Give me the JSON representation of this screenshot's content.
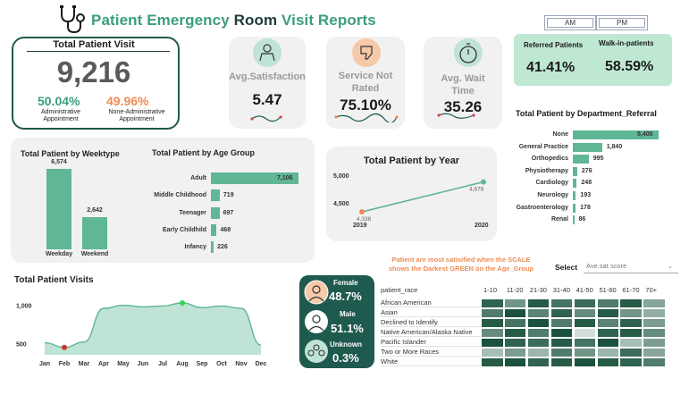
{
  "header": {
    "title_part1": "Patient",
    "title_part2": "Emergency",
    "title_part3": "Room",
    "title_part4": "Visit Reports",
    "am_label": "AM",
    "pm_label": "PM"
  },
  "total_visit": {
    "title": "Total Patient Visit",
    "value": "9,216",
    "admin_pct": "50.04%",
    "admin_label_1": "Administrative",
    "admin_label_2": "Appointment",
    "nonadmin_pct": "49.96%",
    "nonadmin_label_1": "None-Administrative",
    "nonadmin_label_2": "Appointment"
  },
  "kpis": {
    "satisfaction_label": "Avg.Satisfaction",
    "satisfaction_value": "5.47",
    "not_rated_label_1": "Service Not",
    "not_rated_label_2": "Rated",
    "not_rated_value": "75.10%",
    "wait_label_1": "Avg. Wait",
    "wait_label_2": "Time",
    "wait_value": "35.26"
  },
  "referral": {
    "referred_label": "Referred Patients",
    "walkin_label": "Walk-in-patients",
    "referred_value": "41.41%",
    "walkin_value": "58.59%"
  },
  "colors": {
    "accent": "#5fb795",
    "dark_teal": "#1f5a4e",
    "orange": "#f08c55"
  },
  "weektype": {
    "title": "Total Patient by Weektype",
    "chart_data": {
      "type": "bar",
      "categories": [
        "Weekday",
        "Weekend"
      ],
      "values": [
        6574,
        2642
      ],
      "labels": [
        "6,574",
        "2,642"
      ]
    }
  },
  "age_group": {
    "title": "Total Patient by Age Group",
    "chart_data": {
      "type": "bar",
      "categories": [
        "Adult",
        "Middle Childhood",
        "Teenager",
        "Early Childhild",
        "Infancy"
      ],
      "values": [
        7106,
        719,
        697,
        468,
        226
      ],
      "labels": [
        "7,106",
        "719",
        "697",
        "468",
        "226"
      ]
    }
  },
  "year": {
    "title": "Total Patient by Year",
    "chart_data": {
      "type": "line",
      "x": [
        "2019",
        "2020"
      ],
      "values": [
        4338,
        4878
      ],
      "labels": [
        "4,338",
        "4,878"
      ],
      "ylim": [
        4000,
        5000
      ],
      "yticks": [
        "5,000",
        "4,500"
      ]
    }
  },
  "department": {
    "title": "Total Patient by Department_Referral",
    "chart_data": {
      "type": "bar",
      "categories": [
        "None",
        "General Practice",
        "Orthopedics",
        "Physiotherapy",
        "Cardiology",
        "Neurology",
        "Gastroenterology",
        "Renal"
      ],
      "values": [
        5400,
        1840,
        995,
        276,
        248,
        193,
        178,
        86
      ],
      "labels": [
        "5,400",
        "1,840",
        "995",
        "276",
        "248",
        "193",
        "178",
        "86"
      ]
    }
  },
  "visits": {
    "title": "Total Patient Visits",
    "chart_data": {
      "type": "area",
      "x": [
        "Jan",
        "Feb",
        "Mar",
        "Apr",
        "May",
        "Jun",
        "Jul",
        "Aug",
        "Sep",
        "Oct",
        "Nov",
        "Dec"
      ],
      "values": [
        510,
        450,
        520,
        960,
        1000,
        980,
        990,
        1030,
        970,
        990,
        960,
        480
      ],
      "yticks": [
        "1,000",
        "500"
      ],
      "ylim": [
        400,
        1100
      ]
    }
  },
  "gender": {
    "female_label": "Female",
    "female_value": "48.7%",
    "male_label": "Male",
    "male_value": "51.1%",
    "unknown_label": "Unknown",
    "unknown_value": "0.3%"
  },
  "heatmap": {
    "note_1": "Patient are most satisified when the SCALE",
    "note_2": "shows the Darkest GREEN on the Age_Group",
    "select_label": "Select",
    "select_value": "Ave.sat score",
    "row_header": "patient_race",
    "columns": [
      "1-10",
      "11-20",
      "21-30",
      "31-40",
      "41-50",
      "51-60",
      "61-70",
      "70+"
    ],
    "rows": [
      "African American",
      "Asian",
      "Declined to Identify",
      "Native American/Alaska Native",
      "Pacific Islander",
      "Two or More Races",
      "White"
    ],
    "chart_data": {
      "type": "heatmap",
      "values": [
        [
          0.85,
          0.55,
          0.9,
          0.75,
          0.8,
          0.7,
          0.9,
          0.45
        ],
        [
          0.7,
          0.95,
          0.65,
          0.85,
          0.6,
          0.9,
          0.55,
          0.4
        ],
        [
          0.9,
          0.75,
          0.95,
          0.7,
          0.9,
          0.65,
          0.85,
          0.5
        ],
        [
          0.6,
          0.9,
          0.7,
          0.95,
          0.1,
          0.85,
          0.9,
          0.6
        ],
        [
          0.95,
          0.85,
          0.8,
          0.9,
          0.75,
          0.95,
          0.3,
          0.5
        ],
        [
          0.3,
          0.5,
          0.35,
          0.7,
          0.55,
          0.35,
          0.8,
          0.45
        ],
        [
          0.9,
          0.95,
          0.85,
          0.9,
          0.95,
          0.9,
          0.85,
          0.7
        ]
      ]
    }
  }
}
